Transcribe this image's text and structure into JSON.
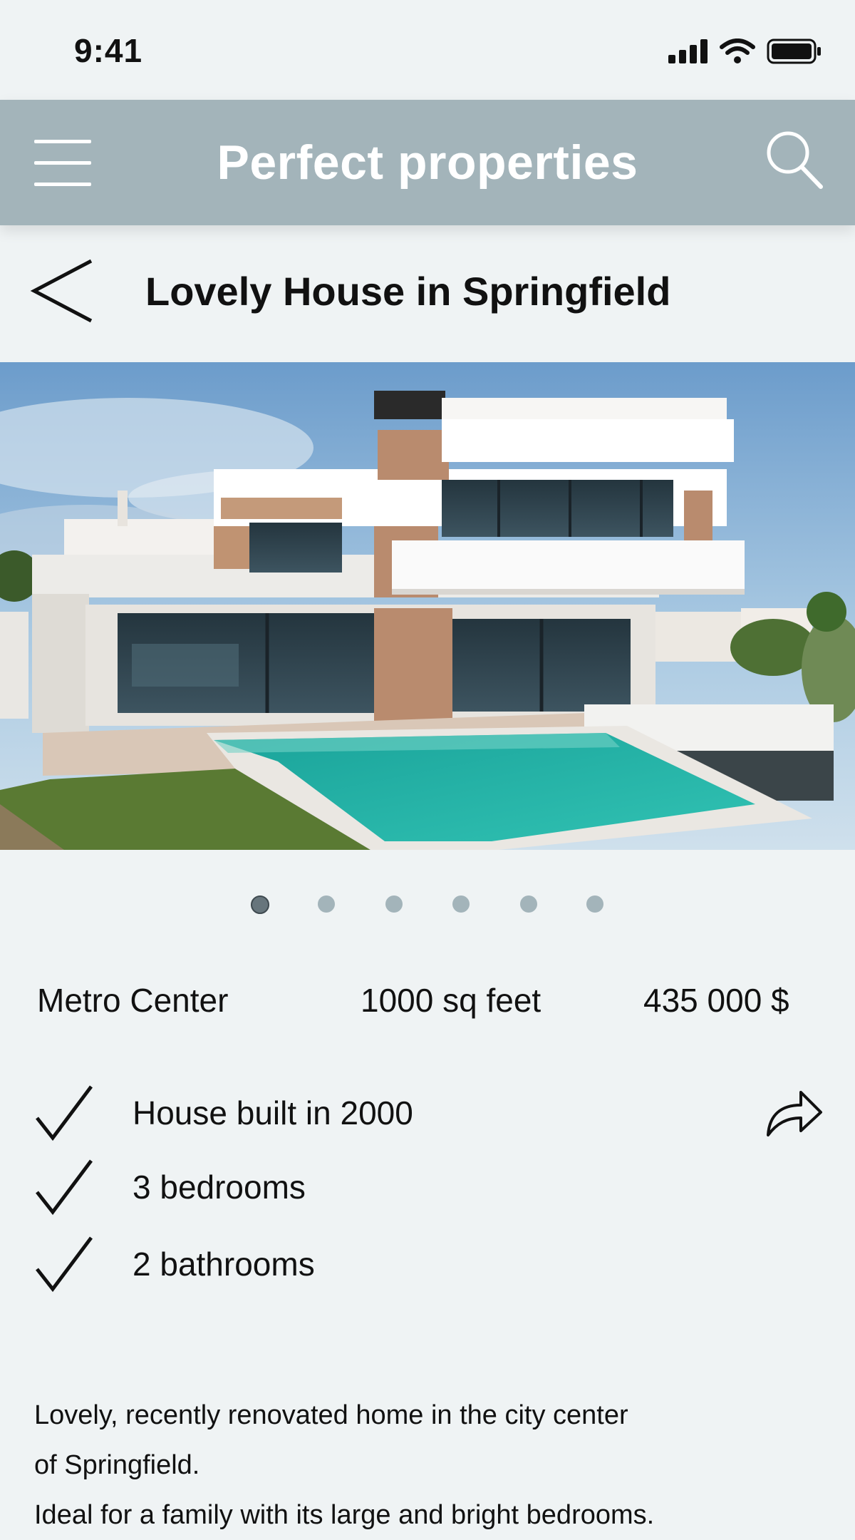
{
  "status_bar": {
    "time": "9:41",
    "icons": [
      "cellular-signal-icon",
      "wifi-icon",
      "battery-icon"
    ]
  },
  "app_bar": {
    "title": "Perfect properties",
    "background_color": "#a3b4ba",
    "left_icon": "hamburger-menu-icon",
    "right_icon": "search-icon"
  },
  "page": {
    "back_icon": "chevron-left-icon",
    "title": "Lovely House in Springfield"
  },
  "gallery": {
    "image_alt": "Modern two-storey white house with pool",
    "dot_count": 6,
    "active_index": 0
  },
  "property": {
    "location": "Metro Center",
    "area": "1000 sq feet",
    "price": "435 000 $"
  },
  "features": [
    {
      "icon": "checkmark-icon",
      "label": "House built in 2000"
    },
    {
      "icon": "checkmark-icon",
      "label": "3 bedrooms"
    },
    {
      "icon": "checkmark-icon",
      "label": "2 bathrooms"
    }
  ],
  "share_icon": "share-arrow-icon",
  "description": {
    "lines": [
      "Lovely, recently renovated home in the city center",
      "of Springfield.",
      "Ideal for a family with its large and bright bedrooms."
    ]
  }
}
